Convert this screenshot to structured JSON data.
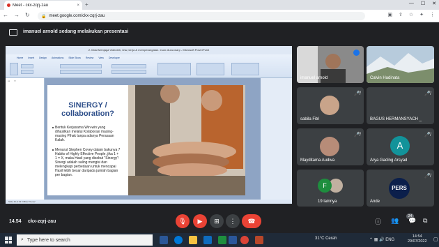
{
  "browser": {
    "tab_title": "Meet - ckx-zqrj-zau",
    "new_tab": "+",
    "url": "meet.google.com/ckx-zqrj-zau",
    "close_tab": "×"
  },
  "banner": {
    "presenter_text": "imanuel arnold sedang melakukan presentasi"
  },
  "ppt": {
    "window_title": "2. Mdul Menjaga Videoteh, khw, kerja & memperangatan. eson diuna warp - Microsoft PowerPoint",
    "ribbon_tabs": [
      "Home",
      "Insert",
      "Design",
      "Animations",
      "Slide Show",
      "Review",
      "View",
      "Developer"
    ],
    "slide_title": "SINERGY / collaboration?",
    "bullet1": "Bentuk Kerjasama Win-win yang dihasilkan melalui Kolaborasi masing-masing Pihak tanpa adanya Perasaan Kalah.",
    "bullet2": "Menurut Stephen Covey dalam bukunya 7 Habits of Highly Effective People, jika 1 + 1 = X, maka Hasil yang disebut \"Sinergy\": Sinergi adalah saling mengisi dan melengkapi perbedaan untuk mencapai Hasil lebih besar daripada jumlah bagian per bagian.",
    "status": "Slide 15 of 29    \"Office Theme\""
  },
  "tiles": [
    {
      "name": "imanuel arnold",
      "type": "video",
      "color": "#6b5a4a"
    },
    {
      "name": "Calvin Hadinata",
      "type": "video",
      "color": "#9fb6c9"
    },
    {
      "name": "sabila Fitri",
      "type": "avatar",
      "color": "#c9a48a"
    },
    {
      "name": "BAGUS HERMANSYACH _",
      "type": "dark",
      "color": "#3c4043"
    },
    {
      "name": "Mayditama Audiva",
      "type": "avatar",
      "color": "#b78c78"
    },
    {
      "name": "Arya Gading Arsyad",
      "type": "letter",
      "letter": "A",
      "color": "#12939a"
    },
    {
      "name": "19 lainnya",
      "type": "group",
      "letter": "F",
      "color": "#1e8e3e"
    },
    {
      "name": "Ande",
      "type": "logo",
      "logo_text": "PERS",
      "color": "#0b1f4b"
    }
  ],
  "bottom": {
    "time": "14.54",
    "meeting_code": "ckx-zqrj-zau",
    "participant_count": "24"
  },
  "taskbar": {
    "search_placeholder": "Type here to search",
    "weather": "31°C  Cerah",
    "lang": "ENG",
    "time": "14:54",
    "date": "29/07/2022"
  }
}
